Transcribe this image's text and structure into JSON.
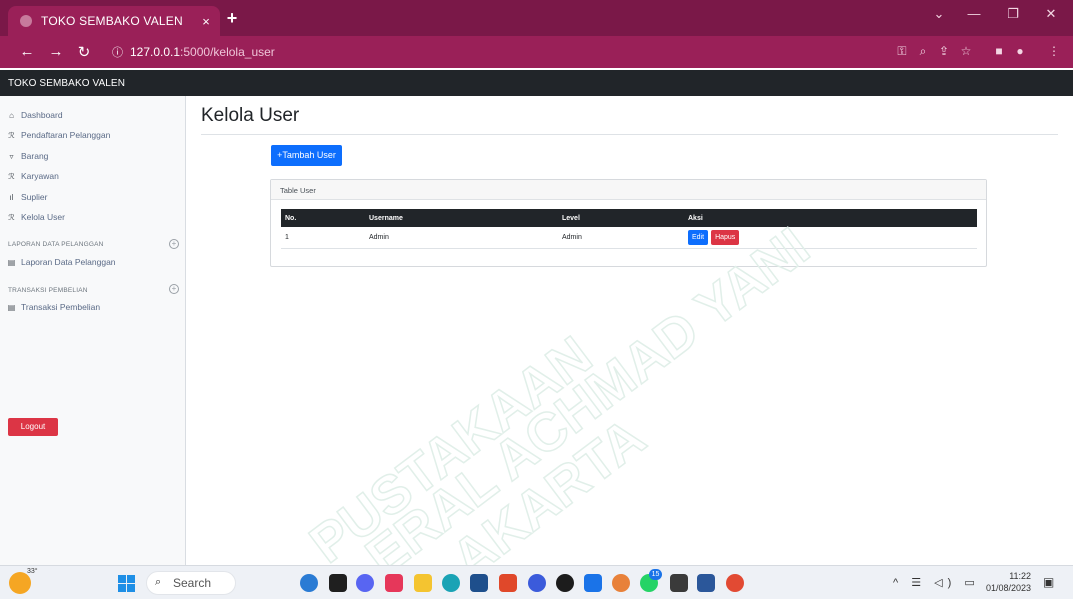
{
  "browser": {
    "tab_title": "TOKO SEMBAKO VALEN",
    "tab_close": "×",
    "new_tab": "+",
    "url_host": "127.0.0.1",
    "url_path": ":5000/kelola_user",
    "info_icon": "ⓘ",
    "accent": "#9a2058"
  },
  "app": {
    "brand": "TOKO SEMBAKO VALEN"
  },
  "sidebar": {
    "items": [
      {
        "label": "Dashboard",
        "icon": "home-icon"
      },
      {
        "label": "Pendaftaran Pelanggan",
        "icon": "users-icon"
      },
      {
        "label": "Barang",
        "icon": "cart-icon"
      },
      {
        "label": "Karyawan",
        "icon": "users-icon"
      },
      {
        "label": "Suplier",
        "icon": "bar-chart-icon"
      },
      {
        "label": "Kelola User",
        "icon": "user-icon"
      }
    ],
    "section1_heading": "LAPORAN DATA PELANGGAN",
    "section1_item": "Laporan Data Pelanggan",
    "section2_heading": "TRANSAKSI PEMBELIAN",
    "section2_item": "Transaksi Pembelian",
    "logout_label": "Logout"
  },
  "main": {
    "title": "Kelola User",
    "add_button": "+Tambah User",
    "card_title": "Table User",
    "table": {
      "headers": [
        "No.",
        "Username",
        "Level",
        "Aksi"
      ],
      "rows": [
        {
          "no": "1",
          "username": "Admin",
          "level": "Admin",
          "edit": "Edit",
          "delete": "Hapus"
        }
      ]
    }
  },
  "watermark": {
    "lines": [
      "PUSTAKAAN",
      "ERAL ACHMAD YANI",
      "AKARTA"
    ]
  },
  "taskbar": {
    "temperature": "33°",
    "search_label": "Search",
    "time": "11:22",
    "date": "01/08/2023",
    "badge_count": "15"
  }
}
